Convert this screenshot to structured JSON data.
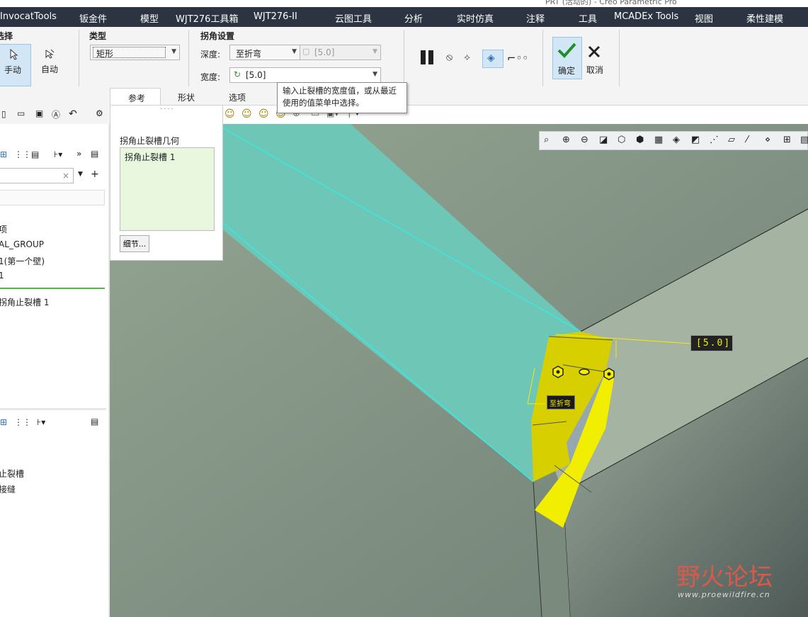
{
  "window_title": "PRT (活动的) - Creo Parametric Pro",
  "menu": {
    "items": [
      "InvocatTools",
      "钣金件",
      "模型",
      "WJT276工具箱",
      "WJT276-II",
      "云图工具",
      "分析",
      "实时仿真",
      "注释",
      "工具",
      "MCADEx Tools",
      "视图",
      "柔性建模"
    ]
  },
  "ribbon": {
    "select_group_label": "选择",
    "manual_label": "手动",
    "auto_label": "自动",
    "type_group_label": "类型",
    "type_value": "矩形",
    "corner_group_label": "拐角设置",
    "depth_label": "深度:",
    "depth_value": "至折弯",
    "depth_secondary": "[5.0]",
    "width_label": "宽度:",
    "width_value": "[5.0]",
    "confirm_label": "确定",
    "cancel_label": "取消",
    "tabs": [
      "参考",
      "形状",
      "选项"
    ]
  },
  "tooltip": {
    "line1": "输入止裂槽的宽度值，或从最近",
    "line2": "使用的值菜单中选择。"
  },
  "ref_panel": {
    "title": "拐角止裂槽几何",
    "item": "拐角止裂槽 1",
    "details_button": "细节..."
  },
  "tree": {
    "items": [
      "项",
      "AL_GROUP",
      "1(第一个壁)",
      "1",
      "拐角止裂槽 1"
    ],
    "lower_items": [
      "止裂槽",
      "接缝"
    ]
  },
  "viewport": {
    "dim_label": "[5.0]",
    "depth_tag": "至折弯"
  },
  "watermark": {
    "text": "野火论坛",
    "url": "www.proewildfire.cn"
  },
  "colors": {
    "menubar": "#2b3440",
    "model_face": "#6dc6b6",
    "relief": "#f2ee00",
    "background": "#8b9a8c"
  }
}
